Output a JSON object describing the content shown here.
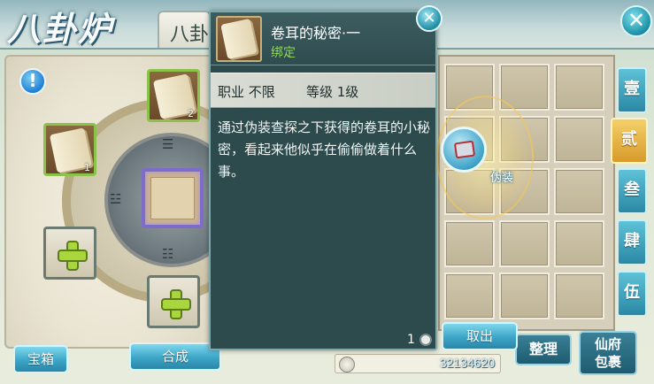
{
  "header": {
    "title": "八卦炉",
    "tab_label": "八卦",
    "close_symbol": "✕"
  },
  "left_panel": {
    "info_symbol": "!",
    "slots": [
      {
        "kind": "scroll",
        "count": "2"
      },
      {
        "kind": "scroll",
        "count": "1"
      },
      {
        "kind": "add",
        "count": ""
      },
      {
        "kind": "add",
        "count": ""
      }
    ],
    "bagua_marks": [
      "☰",
      "☷",
      "☳",
      "☴"
    ]
  },
  "side_tabs": [
    {
      "label": "壹",
      "active": false
    },
    {
      "label": "贰",
      "active": true
    },
    {
      "label": "叁",
      "active": false
    },
    {
      "label": "肆",
      "active": false
    },
    {
      "label": "伍",
      "active": false
    }
  ],
  "disguise": {
    "label": "伪装",
    "icon": "scroll-icon"
  },
  "tooltip": {
    "item_name": "卷耳的秘密·一",
    "bound_label": "绑定",
    "stat_profession": "职业  不限",
    "stat_level": "等级  1级",
    "description": "通过伪装查探之下获得的卷耳的小秘密，看起来他似乎在偷偷做着什么事。",
    "count": "1",
    "close_symbol": "✕",
    "icon": "scroll-icon",
    "bound_color": "#8fd85a"
  },
  "buttons": {
    "treasure_chest": "宝箱",
    "synthesize": "合成",
    "take_out": "取出",
    "organize": "整理",
    "xianfu_bag": "仙府\n包裹"
  },
  "currency": {
    "value": "32134620",
    "icon": "coin-icon"
  },
  "colors": {
    "accent_cyan": "#3ca5c7",
    "active_tab_gold": "#d79a2a",
    "tooltip_bg": "#2d4a4d"
  }
}
